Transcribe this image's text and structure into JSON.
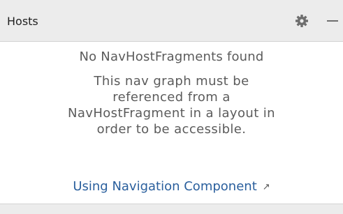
{
  "header": {
    "title": "Hosts",
    "icons": [
      "gear-icon",
      "hide-icon"
    ]
  },
  "empty_state": {
    "title": "No NavHostFragments found",
    "body_lines": [
      "This nav graph must be",
      "referenced from a",
      "NavHostFragment in a layout in",
      "order to be accessible."
    ],
    "link_label": "Using Navigation Component",
    "link_icon": "external-link-arrow-icon"
  },
  "colors": {
    "header_bg": "#ececec",
    "text_muted": "#5b5b5b",
    "link": "#2a5f9d"
  }
}
